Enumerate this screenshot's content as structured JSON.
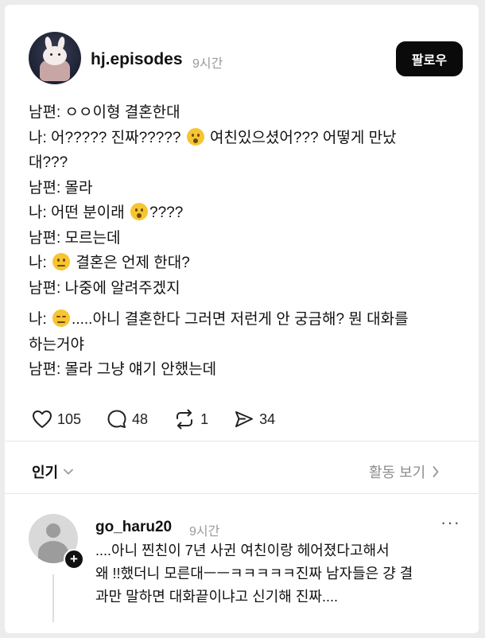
{
  "post": {
    "username": "hj.episodes",
    "time": "9시간",
    "follow_label": "팔로우",
    "lines": {
      "l1": "남편: ㅇㅇ이형 결혼한대",
      "l2a": "나: 어????? 진짜?????",
      "l2b": "여친있으셨어??? 어떻게 만났",
      "l3": "대???",
      "l4": "남편: 몰라",
      "l5a": "나: 어떤 분이래",
      "l5b": "????",
      "l6": "남편: 모르는데",
      "l7a": "나:",
      "l7b": "결혼은 언제 한대?",
      "l8": "남편: 나중에 알려주겠지",
      "l9a": "나:",
      "l9b": ".....아니 결혼한다 그러면 저런게 안 궁금해? 뭔 대화를",
      "l10": "하는거야",
      "l11": "남편: 몰라 그냥 얘기 안했는데"
    },
    "emojis": [
      "astonished-face",
      "hushed-face",
      "neutral-face",
      "expressionless-face"
    ],
    "actions": {
      "likes": "105",
      "comments": "48",
      "reposts": "1",
      "shares": "34"
    }
  },
  "sort": {
    "label": "인기",
    "activity_label": "활동 보기"
  },
  "comment": {
    "username": "go_haru20",
    "time": "9시간",
    "more": "···",
    "line1": "....아니 찐친이 7년 사귄 여친이랑 헤어졌다고해서",
    "line2": "왜 !!했더니 모른대ㅡㅡㅋㅋㅋㅋㅋ진짜 남자들은 걍 결",
    "line3": "과만 말하면 대화끝이냐고 신기해 진짜...."
  }
}
